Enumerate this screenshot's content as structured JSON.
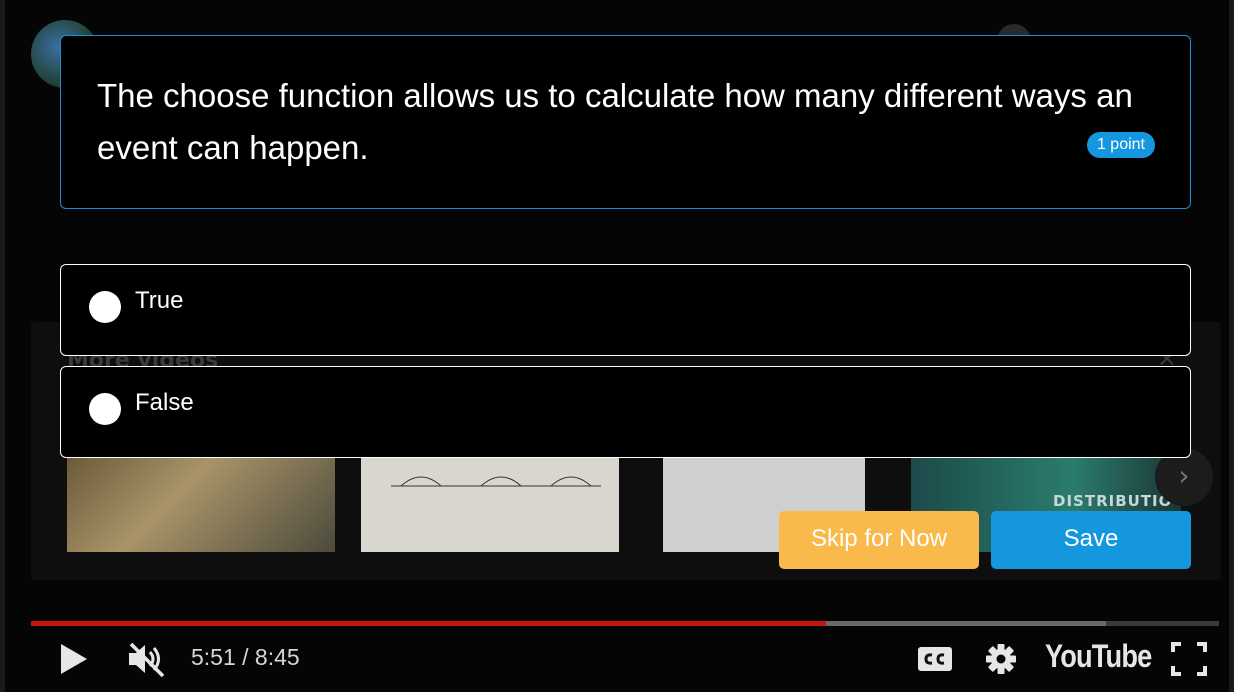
{
  "quiz": {
    "question": "The choose function allows us to calculate how many different ways an event can happen.",
    "points": "1 point",
    "options": [
      {
        "label": "True"
      },
      {
        "label": "False"
      }
    ],
    "skip_label": "Skip for Now",
    "save_label": "Save"
  },
  "more_videos": {
    "title": "More videos",
    "close": "×",
    "thumb4_caption": "DISTRIBUTIO",
    "next": "›"
  },
  "player": {
    "time": "5:51 / 8:45",
    "progress_played_fraction": 0.669,
    "progress_buffered_fraction": 0.905,
    "logo": "YouTube"
  },
  "colors": {
    "accent": "#1597e0",
    "skip": "#f9b94b",
    "progress": "#c4170d"
  }
}
